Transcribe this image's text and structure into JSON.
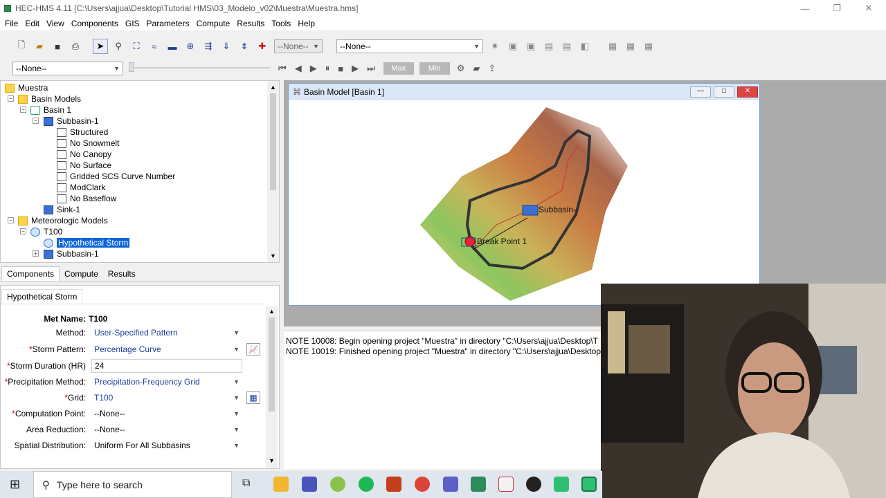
{
  "window": {
    "title": "HEC-HMS 4.11 [C:\\Users\\ajjua\\Desktop\\Tutorial HMS\\03_Modelo_v02\\Muestra\\Muestra.hms]"
  },
  "menu": [
    "File",
    "Edit",
    "View",
    "Components",
    "GIS",
    "Parameters",
    "Compute",
    "Results",
    "Tools",
    "Help"
  ],
  "toolbar": {
    "combo_small": "--None--",
    "combo_large": "--None--",
    "combo_left": "--None--",
    "max_label": "Max",
    "min_label": "Min"
  },
  "tree": {
    "root": "Muestra",
    "basin_models": "Basin Models",
    "basin1": "Basin 1",
    "subbasin": "Subbasin-1",
    "methods": [
      "Structured",
      "No Snowmelt",
      "No Canopy",
      "No Surface",
      "Gridded SCS Curve Number",
      "ModClark",
      "No Baseflow"
    ],
    "sink": "Sink-1",
    "met_models": "Meteorologic Models",
    "t100": "T100",
    "hypo": "Hypothetical Storm",
    "subbasin2": "Subbasin-1"
  },
  "lower_tabs": [
    "Components",
    "Compute",
    "Results"
  ],
  "props": {
    "tab": "Hypothetical Storm",
    "met_name_label": "Met Name:",
    "met_name": "T100",
    "fields": [
      {
        "label": "Method:",
        "req": "",
        "value": "User-Specified Pattern",
        "kind": "combo"
      },
      {
        "label": "Storm Pattern:",
        "req": "*",
        "value": "Percentage Curve",
        "kind": "combo"
      },
      {
        "label": "Storm Duration (HR)",
        "req": "*",
        "value": "24",
        "kind": "input"
      },
      {
        "label": "Precipitation Method:",
        "req": "*",
        "value": "Precipitation-Frequency Grid",
        "kind": "combo"
      },
      {
        "label": "Grid:",
        "req": "*",
        "value": "T100",
        "kind": "combo"
      },
      {
        "label": "Computation Point:",
        "req": "*",
        "value": "--None--",
        "kind": "combo"
      },
      {
        "label": "Area Reduction:",
        "req": "",
        "value": "--None--",
        "kind": "combo"
      },
      {
        "label": "Spatial Distribution:",
        "req": "",
        "value": "Uniform For All Subbasins",
        "kind": "combo"
      }
    ]
  },
  "basin_window": {
    "title": "Basin Model [Basin 1]",
    "label_subbasin": "Subbasin-",
    "label_break": "Break Point 1"
  },
  "messages": [
    "NOTE 10008:  Begin opening project \"Muestra\" in directory \"C:\\Users\\ajjua\\Desktop\\T",
    "NOTE 10019:  Finished opening project \"Muestra\" in directory \"C:\\Users\\ajjua\\Desktop"
  ],
  "taskbar": {
    "search_placeholder": "Type here to search"
  },
  "colors": {
    "selection": "#0a64d8",
    "required": "#cc0000",
    "value_text": "#1d3fa0"
  }
}
